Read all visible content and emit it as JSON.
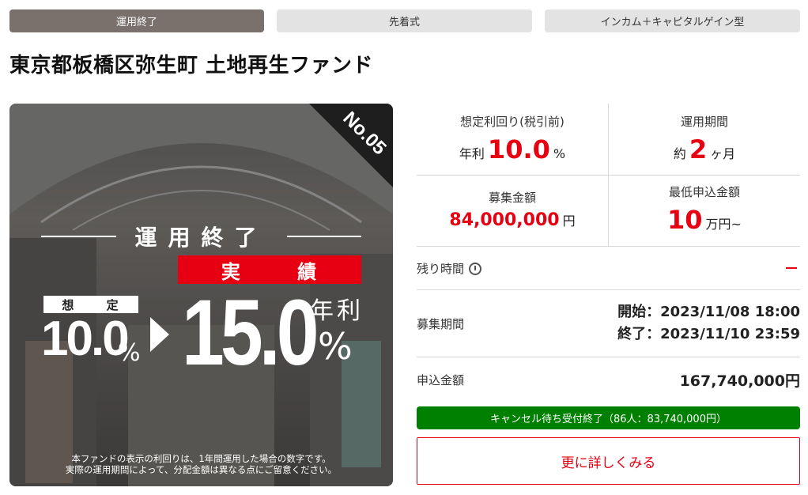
{
  "tags": [
    "運用終了",
    "先着式",
    "インカム＋キャピタルゲイン型"
  ],
  "title": "東京都板橋区弥生町 土地再生ファンド",
  "hero": {
    "fund_no": "No.05",
    "status": "運用終了",
    "result_label": "実 績",
    "assumed_label": "想 定",
    "assumed_value": "10.0",
    "assumed_unit": "%",
    "actual_value": "15.0",
    "annual_label": "年利",
    "actual_unit": "%",
    "disclaimer_line1": "本ファンドの表示の利回りは、1年間運用した場合の数字です。",
    "disclaimer_line2": "実際の運用期間によって、分配金額は異なる点にご留意ください。"
  },
  "stats": {
    "yield_label": "想定利回り(税引前)",
    "yield_prefix": "年利",
    "yield_value": "10.0",
    "yield_unit": "%",
    "period_label": "運用期間",
    "period_prefix": "約",
    "period_value": "2",
    "period_unit": "ヶ月",
    "raise_label": "募集金額",
    "raise_value": "84,000,000",
    "raise_unit": "円",
    "min_label": "最低申込金額",
    "min_value": "10",
    "min_unit": "万円~"
  },
  "remaining": {
    "label": "残り時間"
  },
  "recruit": {
    "label": "募集期間",
    "start": "開始：2023/11/08 18:00",
    "end": "終了：2023/11/10 23:59"
  },
  "applied": {
    "label": "申込金額",
    "value": "167,740,000円"
  },
  "cancel_status": "キャンセル待ち受付終了（86人：83,740,000円）",
  "more_button": "更に詳しくみる",
  "colors": {
    "accent_red": "#e60012",
    "green": "#008000",
    "tag_dark": "#7a716d"
  }
}
